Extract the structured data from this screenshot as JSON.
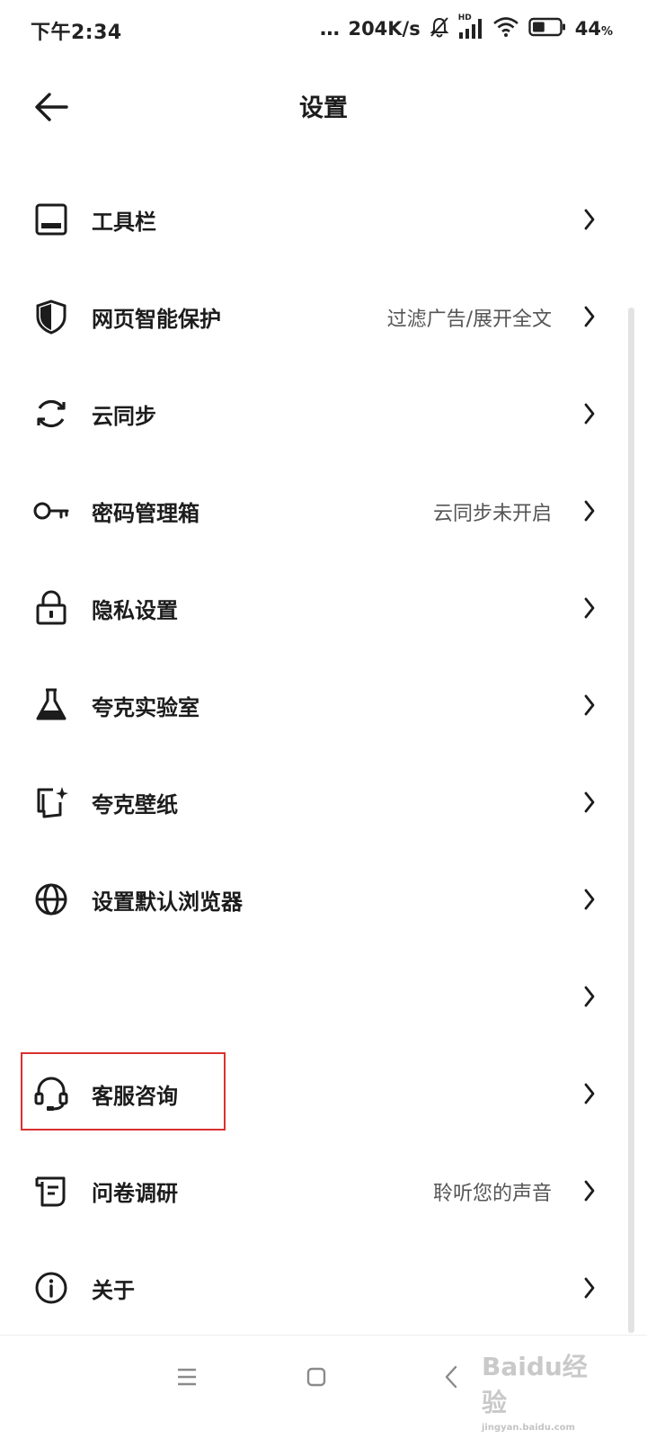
{
  "status_bar": {
    "time": "下午2:34",
    "dots": "...",
    "speed": "204K/s",
    "hd_label": "HD",
    "battery_percent": "44",
    "battery_unit": "%",
    "battery_level": 0.44
  },
  "header": {
    "title": "设置",
    "back_icon": "arrow-left-icon"
  },
  "settings_items": [
    {
      "label": "工具栏",
      "value": "",
      "icon": "toolbar-icon"
    },
    {
      "label": "网页智能保护",
      "value": "过滤广告/展开全文",
      "icon": "shield-icon"
    },
    {
      "label": "云同步",
      "value": "",
      "icon": "sync-icon"
    },
    {
      "label": "密码管理箱",
      "value": "云同步未开启",
      "icon": "key-icon"
    },
    {
      "label": "隐私设置",
      "value": "",
      "icon": "lock-icon"
    },
    {
      "label": "夸克实验室",
      "value": "",
      "icon": "flask-icon"
    },
    {
      "label": "夸克壁纸",
      "value": "",
      "icon": "wallpaper-icon"
    },
    {
      "label": "设置默认浏览器",
      "value": "",
      "icon": "globe-icon"
    },
    {
      "label": "",
      "value": "",
      "icon": ""
    },
    {
      "label": "客服咨询",
      "value": "",
      "icon": "headset-icon"
    },
    {
      "label": "问卷调研",
      "value": "聆听您的声音",
      "icon": "survey-icon"
    },
    {
      "label": "关于",
      "value": "",
      "icon": "info-icon"
    }
  ],
  "highlight_color": "#d9312f",
  "nav": {
    "menu_icon": "menu-icon",
    "home_icon": "home-icon",
    "back_icon": "back-icon"
  },
  "watermark": {
    "text": "Baidu经验",
    "url_text": "jingyan.baidu.com"
  }
}
